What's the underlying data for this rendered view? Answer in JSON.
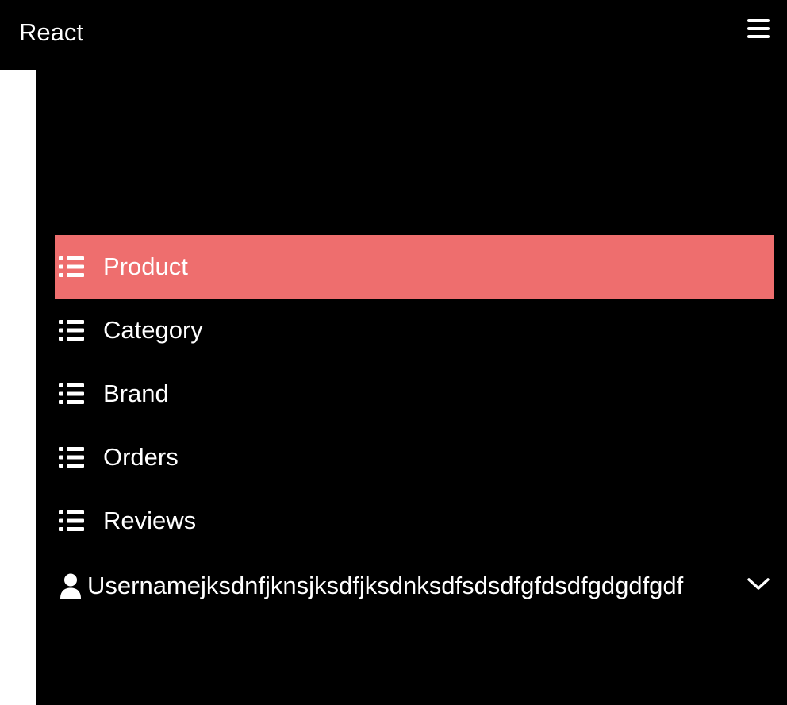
{
  "header": {
    "brand": "React",
    "menu_icon": "hamburger-icon"
  },
  "sidebar": {
    "items": [
      {
        "label": "Product",
        "icon": "list-icon",
        "active": true
      },
      {
        "label": "Category",
        "icon": "list-icon",
        "active": false
      },
      {
        "label": "Brand",
        "icon": "list-icon",
        "active": false
      },
      {
        "label": "Orders",
        "icon": "list-icon",
        "active": false
      },
      {
        "label": "Reviews",
        "icon": "list-icon",
        "active": false
      }
    ],
    "user": {
      "name": "Usernamejksdnfjknsjksdfjksdnksdfsdsdfgfdsdfgdgdfgdf",
      "icon": "user-icon",
      "toggle_icon": "chevron-down-icon"
    }
  },
  "colors": {
    "background": "#000000",
    "active_item": "#ee6e6e",
    "text": "#ffffff",
    "page": "#ffffff"
  }
}
